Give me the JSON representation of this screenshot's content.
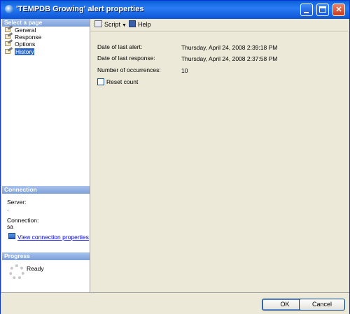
{
  "window": {
    "title": "'TEMPDB Growing' alert properties",
    "buttons": {
      "minimize": "minimize",
      "maximize": "maximize",
      "close": "✕"
    }
  },
  "sidebar": {
    "select_page_header": "Select a page",
    "pages": [
      {
        "label": "General",
        "icon": "page-wrench-icon"
      },
      {
        "label": "Response",
        "icon": "page-wrench-icon"
      },
      {
        "label": "Options",
        "icon": "page-wrench-icon"
      },
      {
        "label": "History",
        "icon": "page-wrench-icon",
        "selected": true
      }
    ],
    "connection_header": "Connection",
    "server_label": "Server:",
    "server_value": ".",
    "connection_label": "Connection:",
    "connection_value": "sa",
    "view_connection_link": "View connection properties",
    "progress_header": "Progress",
    "progress_status": "Ready"
  },
  "toolbar": {
    "script_label": "Script",
    "help_label": "Help"
  },
  "history": {
    "last_alert_label": "Date of last alert:",
    "last_alert_value": "Thursday, April 24, 2008 2:39:18 PM",
    "last_response_label": "Date of last response:",
    "last_response_value": "Thursday, April 24, 2008 2:37:58 PM",
    "occurrences_label": "Number of occurrences:",
    "occurrences_value": "10",
    "reset_count_label": "Reset count",
    "reset_count_checked": false
  },
  "footer": {
    "ok_label": "OK",
    "cancel_label": "Cancel"
  },
  "colors": {
    "titlebar": "#0a5fd8",
    "section_header": "#7d9fd8",
    "selection": "#316ac5",
    "dialog_bg": "#ece9d8"
  }
}
